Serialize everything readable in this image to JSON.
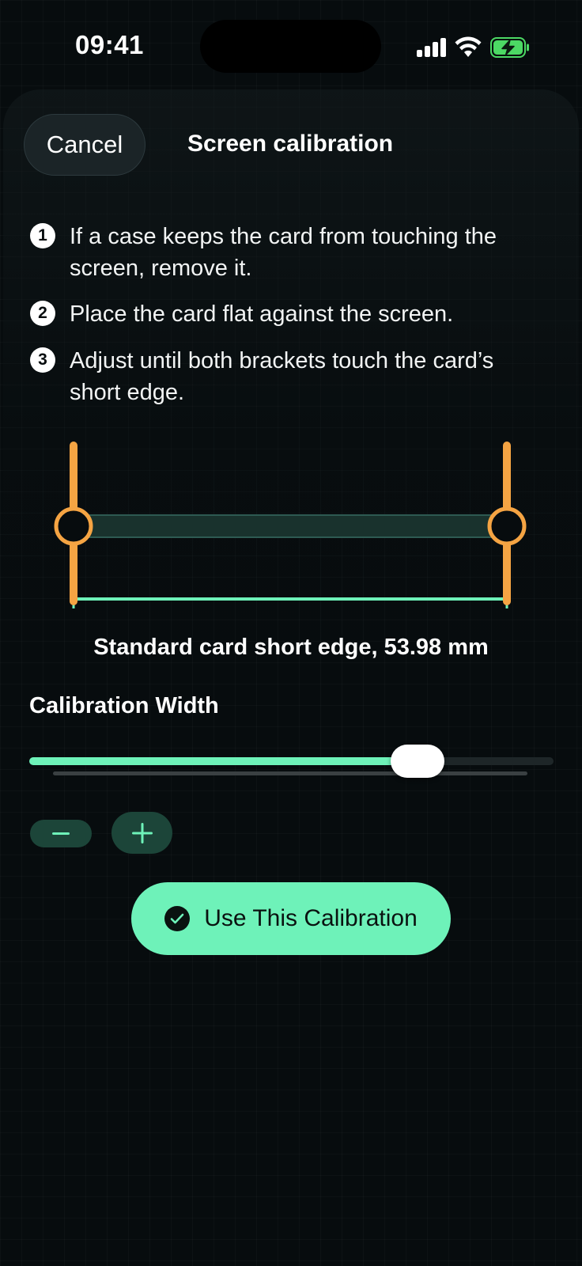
{
  "status_bar": {
    "time": "09:41"
  },
  "header": {
    "cancel_label": "Cancel",
    "title": "Screen calibration"
  },
  "steps": [
    {
      "number": "1",
      "text": "If a case keeps the card from touching the screen, remove it."
    },
    {
      "number": "2",
      "text": "Place the card flat against the screen."
    },
    {
      "number": "3",
      "text": "Adjust until both brackets touch the card’s short edge."
    }
  ],
  "ruler": {
    "caption": "Standard card short edge, 53.98 mm"
  },
  "calibration": {
    "label": "Calibration Width",
    "slider_fraction": 0.74,
    "minus_label": "−",
    "plus_label": "+"
  },
  "primary_action": {
    "label": "Use This Calibration"
  },
  "colors": {
    "accent": "#6ef2b9",
    "bracket": "#f5a443",
    "background": "#070c0e",
    "battery": "#4cd964"
  },
  "icons": {
    "signal": "cellular-signal-icon",
    "wifi": "wifi-icon",
    "battery": "battery-charging-icon",
    "check": "checkmark-circle-icon",
    "minus": "minus-icon",
    "plus": "plus-icon"
  }
}
